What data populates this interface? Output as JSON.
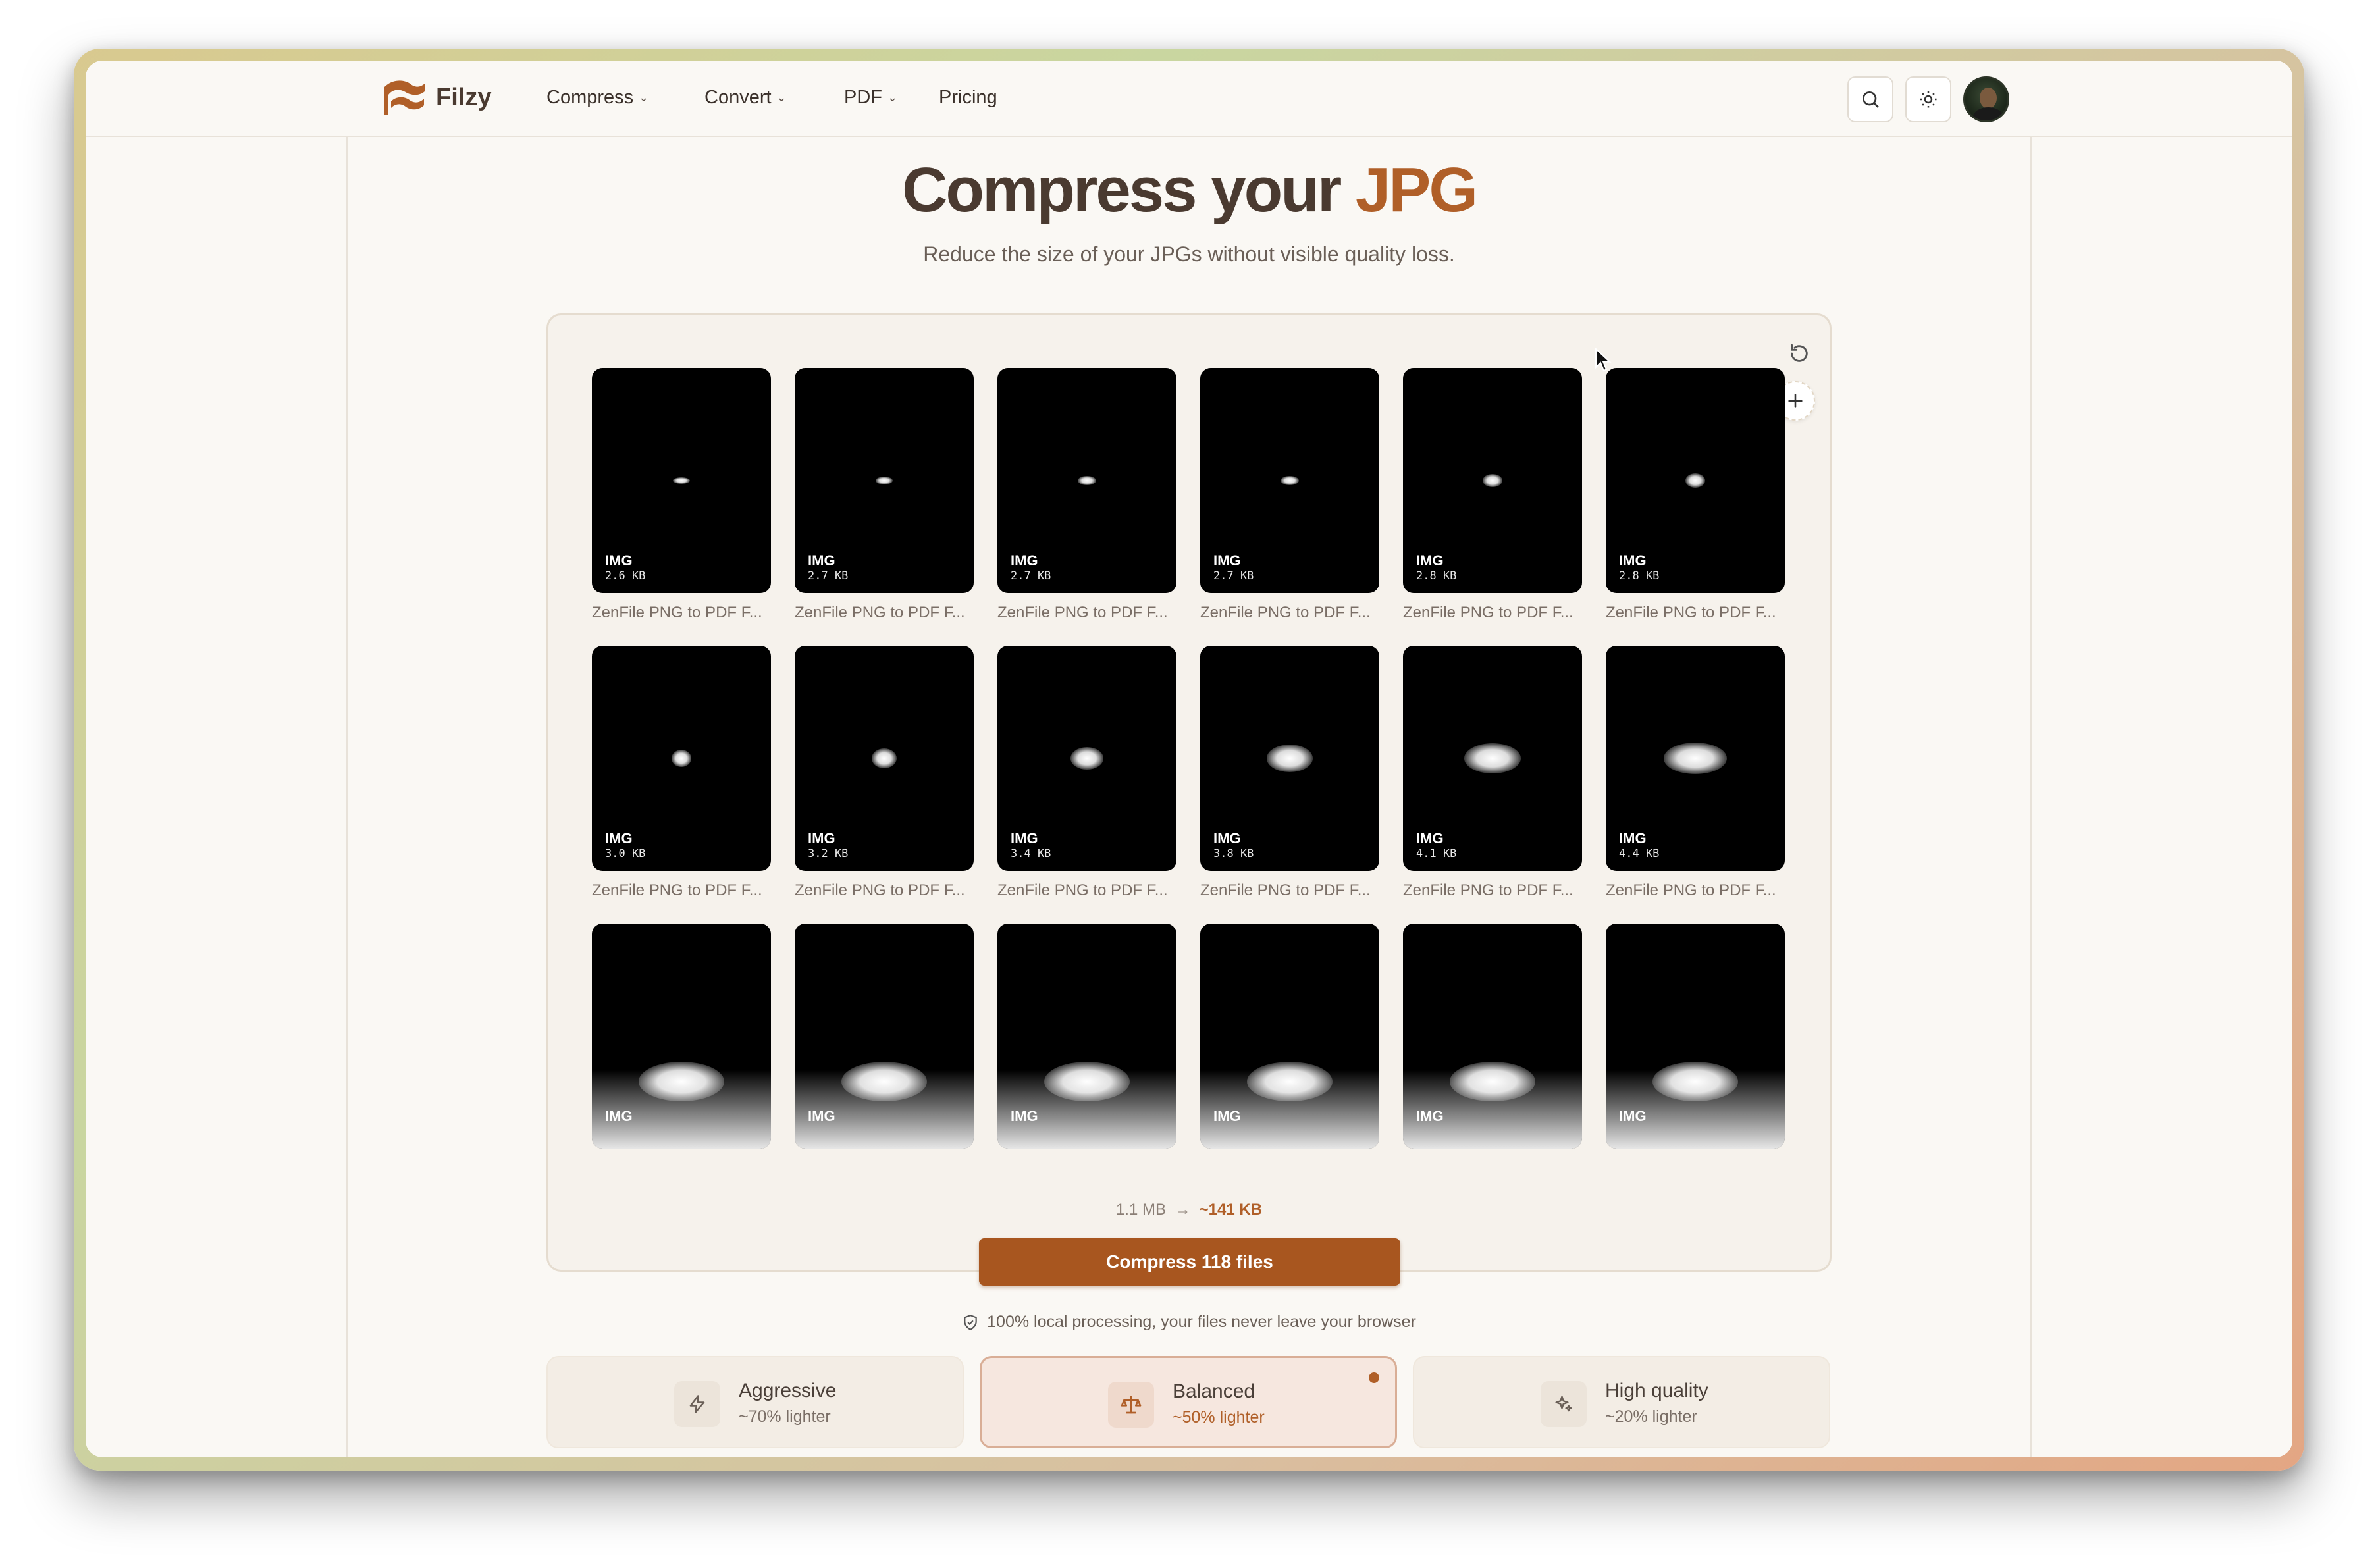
{
  "brand": {
    "name": "Filzy",
    "accent": "#b05f28"
  },
  "nav": {
    "items": [
      {
        "label": "Compress",
        "has_menu": true
      },
      {
        "label": "Convert",
        "has_menu": true
      },
      {
        "label": "PDF",
        "has_menu": true
      },
      {
        "label": "Pricing",
        "has_menu": false
      }
    ]
  },
  "hero": {
    "title_main": "Compress your",
    "title_accent": "JPG",
    "subtitle": "Reduce the size of your JPGs without visible quality loss."
  },
  "files": [
    {
      "kind": "IMG",
      "size": "2.6 KB",
      "name": "ZenFile PNG to PDF F..."
    },
    {
      "kind": "IMG",
      "size": "2.7 KB",
      "name": "ZenFile PNG to PDF F..."
    },
    {
      "kind": "IMG",
      "size": "2.7 KB",
      "name": "ZenFile PNG to PDF F..."
    },
    {
      "kind": "IMG",
      "size": "2.7 KB",
      "name": "ZenFile PNG to PDF F..."
    },
    {
      "kind": "IMG",
      "size": "2.8 KB",
      "name": "ZenFile PNG to PDF F..."
    },
    {
      "kind": "IMG",
      "size": "2.8 KB",
      "name": "ZenFile PNG to PDF F..."
    },
    {
      "kind": "IMG",
      "size": "3.0 KB",
      "name": "ZenFile PNG to PDF F..."
    },
    {
      "kind": "IMG",
      "size": "3.2 KB",
      "name": "ZenFile PNG to PDF F..."
    },
    {
      "kind": "IMG",
      "size": "3.4 KB",
      "name": "ZenFile PNG to PDF F..."
    },
    {
      "kind": "IMG",
      "size": "3.8 KB",
      "name": "ZenFile PNG to PDF F..."
    },
    {
      "kind": "IMG",
      "size": "4.1 KB",
      "name": "ZenFile PNG to PDF F..."
    },
    {
      "kind": "IMG",
      "size": "4.4 KB",
      "name": "ZenFile PNG to PDF F..."
    },
    {
      "kind": "IMG",
      "size": "",
      "name": ""
    },
    {
      "kind": "IMG",
      "size": "",
      "name": ""
    },
    {
      "kind": "IMG",
      "size": "",
      "name": ""
    },
    {
      "kind": "IMG",
      "size": "",
      "name": ""
    },
    {
      "kind": "IMG",
      "size": "",
      "name": ""
    },
    {
      "kind": "IMG",
      "size": "",
      "name": ""
    }
  ],
  "summary": {
    "from": "1.1 MB",
    "arrow": "→",
    "to": "~141 KB",
    "compress_label": "Compress 118 files"
  },
  "privacy_note": "100% local processing, your files never leave your browser",
  "modes": [
    {
      "title": "Aggressive",
      "sub": "~70% lighter",
      "icon": "lightning-icon",
      "active": false
    },
    {
      "title": "Balanced",
      "sub": "~50% lighter",
      "icon": "scale-icon",
      "active": true
    },
    {
      "title": "High quality",
      "sub": "~20% lighter",
      "icon": "sparkle-icon",
      "active": false
    }
  ]
}
